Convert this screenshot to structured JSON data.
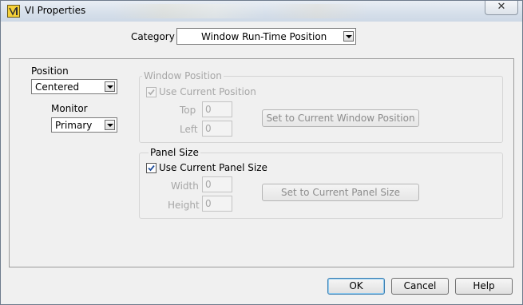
{
  "window": {
    "title": "VI Properties",
    "close_glyph": "✕"
  },
  "category": {
    "label": "Category",
    "value": "Window Run-Time Position"
  },
  "position": {
    "label": "Position",
    "value": "Centered",
    "monitor_label": "Monitor",
    "monitor_value": "Primary"
  },
  "window_position": {
    "group_label": "Window Position",
    "use_current_label": "Use Current Position",
    "use_current_checked": true,
    "top_label": "Top",
    "top_value": "0",
    "left_label": "Left",
    "left_value": "0",
    "set_button": "Set to Current Window Position"
  },
  "panel_size": {
    "group_label": "Panel Size",
    "use_current_label": "Use Current Panel Size",
    "use_current_checked": true,
    "width_label": "Width",
    "width_value": "0",
    "height_label": "Height",
    "height_value": "0",
    "set_button": "Set to Current Panel Size"
  },
  "footer": {
    "ok": "OK",
    "cancel": "Cancel",
    "help": "Help"
  }
}
